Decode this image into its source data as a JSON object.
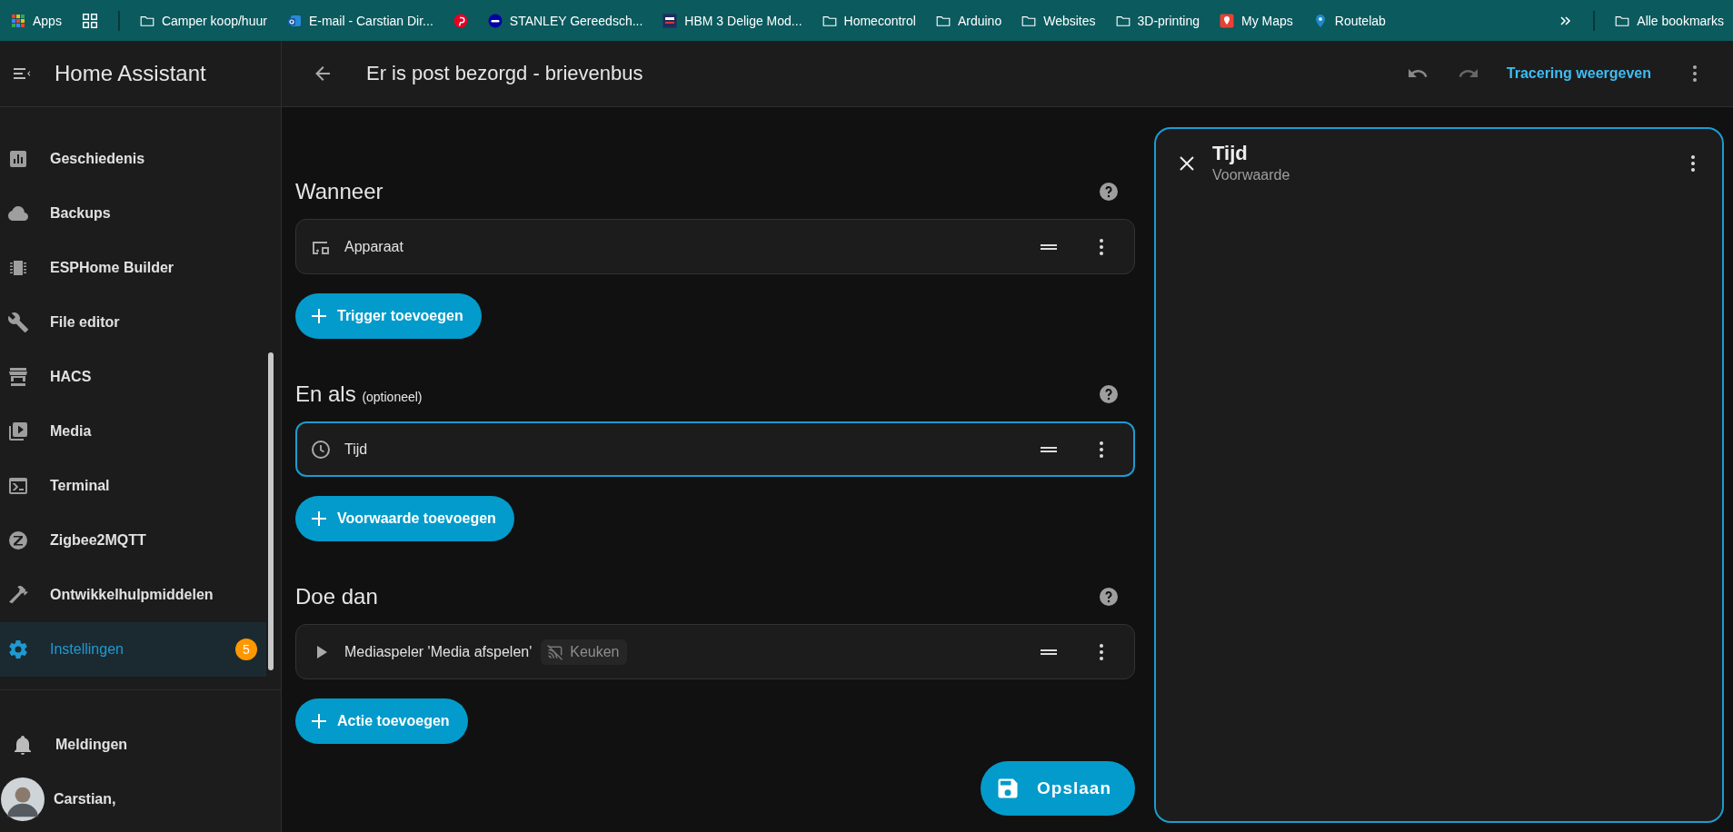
{
  "bookmarks_bar": {
    "items": [
      {
        "kind": "apps",
        "label": "Apps"
      },
      {
        "kind": "folder",
        "label": "Camper koop/huur"
      },
      {
        "kind": "mail",
        "label": "E-mail - Carstian Dir..."
      },
      {
        "kind": "pin"
      },
      {
        "kind": "bol",
        "label": "STANLEY Gereedsch..."
      },
      {
        "kind": "hbm",
        "label": "HBM 3 Delige Mod..."
      },
      {
        "kind": "folder",
        "label": "Homecontrol"
      },
      {
        "kind": "folder",
        "label": "Arduino"
      },
      {
        "kind": "folder",
        "label": "Websites"
      },
      {
        "kind": "folder",
        "label": "3D-printing"
      },
      {
        "kind": "maps",
        "label": "My Maps"
      },
      {
        "kind": "route",
        "label": "Routelab"
      }
    ],
    "all_bookmarks": "Alle bookmarks"
  },
  "sidebar": {
    "title": "Home Assistant",
    "items": [
      {
        "kind": "history",
        "label": "Geschiedenis",
        "selected": false
      },
      {
        "kind": "backups",
        "label": "Backups",
        "selected": false
      },
      {
        "kind": "esphome",
        "label": "ESPHome Builder",
        "selected": false
      },
      {
        "kind": "files",
        "label": "File editor",
        "selected": false
      },
      {
        "kind": "hacs",
        "label": "HACS",
        "selected": false
      },
      {
        "kind": "media",
        "label": "Media",
        "selected": false
      },
      {
        "kind": "terminal",
        "label": "Terminal",
        "selected": false
      },
      {
        "kind": "zigbee",
        "label": "Zigbee2MQTT",
        "selected": false
      },
      {
        "kind": "developer",
        "label": "Ontwikkelhulpmiddelen",
        "selected": false
      },
      {
        "kind": "settings",
        "label": "Instellingen",
        "selected": true,
        "badge": "5"
      }
    ],
    "notifications": "Meldingen",
    "user": "Carstian,"
  },
  "header": {
    "title": "Er is post bezorgd - brievenbus",
    "trace_link": "Tracering weergeven"
  },
  "sections": [
    {
      "title": "Wanneer",
      "items": [
        {
          "kind": "device",
          "label": "Apparaat",
          "selected": false
        }
      ],
      "add_button": "Trigger toevoegen"
    },
    {
      "title": "En als",
      "note": "(optioneel)",
      "items": [
        {
          "kind": "time",
          "label": "Tijd",
          "selected": true
        }
      ],
      "add_button": "Voorwaarde toevoegen"
    },
    {
      "title": "Doe dan",
      "items": [
        {
          "kind": "media",
          "label": "Mediaspeler 'Media afspelen'",
          "chip": "Keuken",
          "selected": false
        }
      ],
      "add_button": "Actie toevoegen"
    }
  ],
  "save_button": "Opslaan",
  "detail_panel": {
    "title": "Tijd",
    "subtitle": "Voorwaarde"
  }
}
